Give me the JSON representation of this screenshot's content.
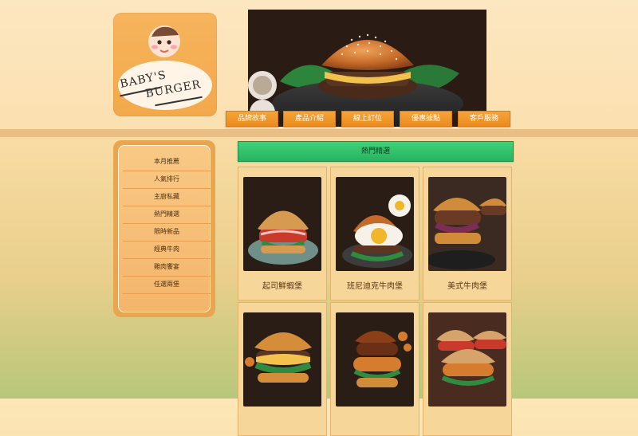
{
  "logo": {
    "line1": "BABY'S",
    "line2": "BURGER"
  },
  "nav": {
    "items": [
      {
        "label": "品牌故事"
      },
      {
        "label": "產品介紹"
      },
      {
        "label": "線上訂位"
      },
      {
        "label": "優惠據點"
      },
      {
        "label": "客戶服務"
      }
    ]
  },
  "sidebar": {
    "items": [
      {
        "label": "本月推薦"
      },
      {
        "label": "人氣排行"
      },
      {
        "label": "主廚私藏"
      },
      {
        "label": "熱門精選"
      },
      {
        "label": "限時新品"
      },
      {
        "label": "經典牛肉"
      },
      {
        "label": "雞肉饗宴"
      },
      {
        "label": "任選兩堡"
      }
    ]
  },
  "main": {
    "section_title": "熱門精選",
    "products": [
      {
        "name": "起司鮮蝦堡",
        "icon": "shrimp-burger-photo"
      },
      {
        "name": "班尼迪克牛肉堡",
        "icon": "egg-burger-photo"
      },
      {
        "name": "美式牛肉堡",
        "icon": "american-burger-photo"
      },
      {
        "name": "",
        "icon": "cheese-burger-photo"
      },
      {
        "name": "",
        "icon": "crispy-chicken-burger-photo"
      },
      {
        "name": "",
        "icon": "fried-chicken-burger-photo"
      }
    ]
  },
  "colors": {
    "accent": "#e98c1e",
    "section_green": "#27b35f",
    "sidebar": "#e9a651",
    "card": "#f7d69a"
  }
}
